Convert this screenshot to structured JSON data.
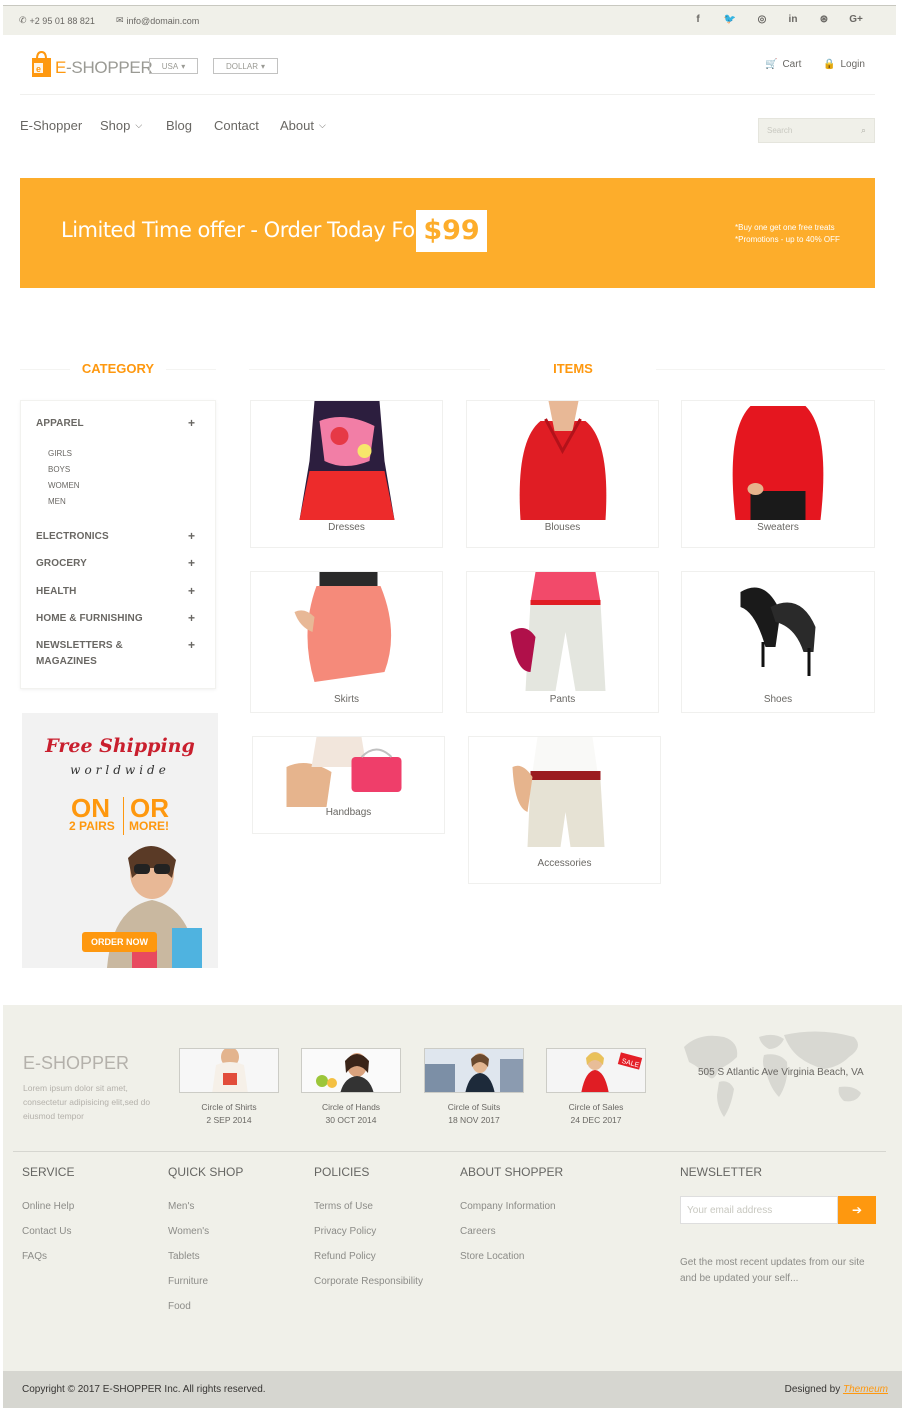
{
  "topbar": {
    "phone": "+2 95 01 88 821",
    "email": "info@domain.com",
    "social": [
      "f",
      "t",
      "ig",
      "in",
      "dr",
      "G+"
    ]
  },
  "header": {
    "logo_left": "E",
    "logo_right": "-SHOPPER",
    "country": "USA",
    "currency": "DOLLAR",
    "cart": "Cart",
    "login": "Login"
  },
  "nav": {
    "items": [
      "E-Shopper",
      "Shop",
      "Blog",
      "Contact",
      "About"
    ],
    "search_placeholder": "Search"
  },
  "banner": {
    "offer": "Limited Time offer - Order Today For",
    "price": "$99",
    "promo1": "*Buy one get one free treats",
    "promo2": "*Promotions - up to 40% OFF"
  },
  "sections": {
    "category": "CATEGORY",
    "items": "ITEMS"
  },
  "categories": {
    "apparel": "APPAREL",
    "sub": [
      "GIRLS",
      "BOYS",
      "WOMEN",
      "MEN"
    ],
    "others": [
      "ELECTRONICS",
      "GROCERY",
      "HEALTH",
      "HOME & FURNISHING",
      "NEWSLETTERS &",
      "MAGAZINES"
    ]
  },
  "promo": {
    "free_shipping": "Free Shipping",
    "worldwide": "worldwide",
    "on": "ON",
    "or": "OR",
    "pairs": "2 PAIRS",
    "more": "MORE!",
    "order": "ORDER NOW"
  },
  "items": [
    "Dresses",
    "Blouses",
    "Sweaters",
    "Skirts",
    "Pants",
    "Shoes",
    "Handbags",
    "Accessories"
  ],
  "footer": {
    "logo": "E-SHOPPER",
    "lorem": "Lorem ipsum dolor sit amet, consectetur adipisicing elit,sed do eiusmod tempor",
    "posts": [
      {
        "title": "Circle of Shirts",
        "date": "2 SEP 2014"
      },
      {
        "title": "Circle of Hands",
        "date": "30 OCT 2014"
      },
      {
        "title": "Circle of Suits",
        "date": "18 NOV 2017"
      },
      {
        "title": "Circle of Sales",
        "date": "24 DEC 2017"
      }
    ],
    "address": "505 S Atlantic Ave Virginia Beach, VA",
    "columns": {
      "service": {
        "title": "SERVICE",
        "links": [
          "Online Help",
          "Contact Us",
          "FAQs"
        ]
      },
      "quick": {
        "title": "QUICK SHOP",
        "links": [
          "Men's",
          "Women's",
          "Tablets",
          "Furniture",
          "Food"
        ]
      },
      "policies": {
        "title": "POLICIES",
        "links": [
          "Terms of Use",
          "Privacy Policy",
          "Refund Policy",
          "Corporate Responsibility"
        ]
      },
      "about": {
        "title": "ABOUT SHOPPER",
        "links": [
          "Company Information",
          "Careers",
          "Store Location"
        ]
      },
      "newsletter": {
        "title": "NEWSLETTER",
        "placeholder": "Your email address",
        "text": "Get the most recent updates from our site and be updated your self..."
      }
    },
    "copyright": "Copyright © 2017 E-SHOPPER Inc. All rights reserved.",
    "designed_by": "Designed by",
    "designer": "Themeum"
  },
  "colors": {
    "accent": "#fe980f",
    "banner": "#fdad2b",
    "footer_bg": "#f0f0e9"
  }
}
